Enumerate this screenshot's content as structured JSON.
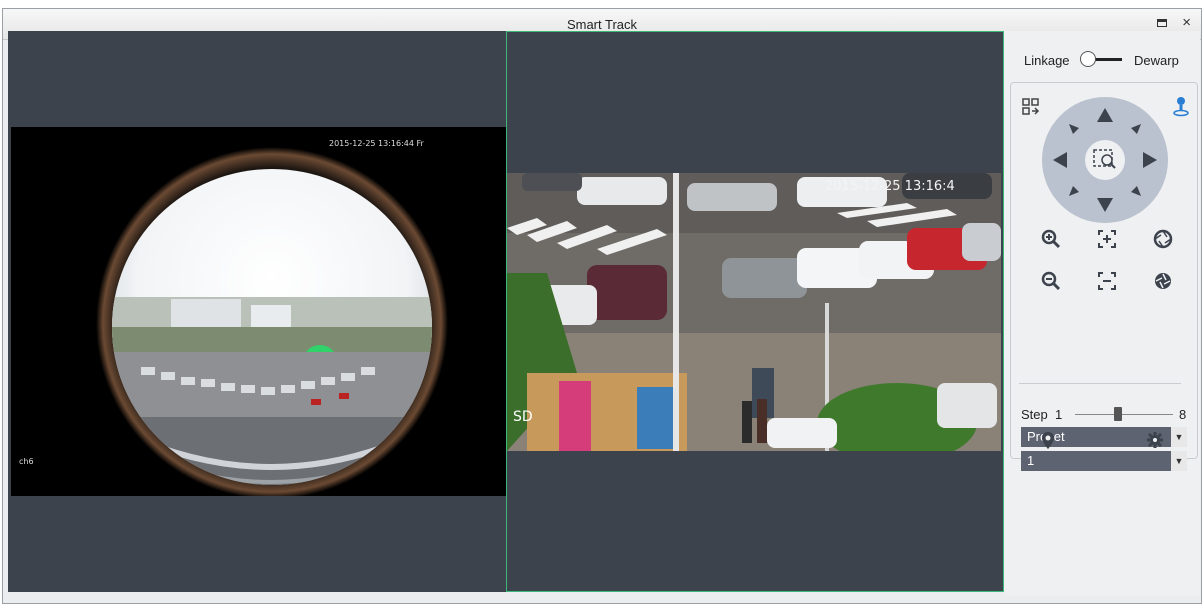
{
  "window": {
    "title": "Smart Track",
    "maximize_icon": "maximize-icon",
    "close_glyph": "×"
  },
  "video": {
    "left_osd_time": "2015-12-25 13:16:44 Fr",
    "left_channel": "ch6",
    "right_osd_time": "2015-12-25 13:16:4",
    "right_label": "SD",
    "active_border_color": "#3cb878"
  },
  "panel": {
    "linkage_label": "Linkage",
    "dewarp_label": "Dewarp",
    "step_label": "Step",
    "step_min": "1",
    "step_max": "8",
    "step_value_fraction": 0.43,
    "preset_select": "Preset",
    "preset_number_select": "1",
    "icons": [
      "layout-switch-icon",
      "person-locate-icon",
      "zoom-in-icon",
      "focus-near-icon",
      "iris-open-icon",
      "zoom-out-icon",
      "focus-far-icon",
      "iris-close-icon",
      "location-pin-icon",
      "gear-icon"
    ]
  }
}
